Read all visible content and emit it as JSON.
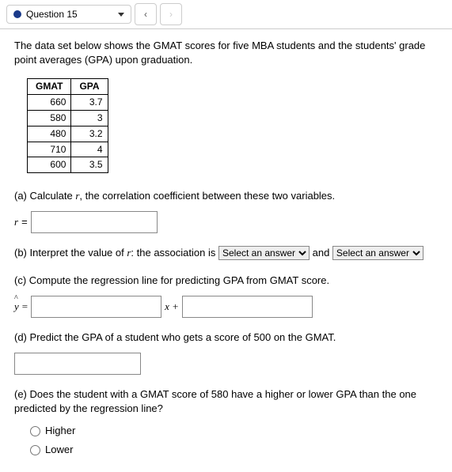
{
  "topbar": {
    "question_label": "Question 15",
    "prev": "‹",
    "next": "›"
  },
  "intro": "The data set below shows the GMAT scores for five MBA students and the students' grade point averages (GPA) upon graduation.",
  "table": {
    "headers": [
      "GMAT",
      "GPA"
    ],
    "rows": [
      [
        "660",
        "3.7"
      ],
      [
        "580",
        "3"
      ],
      [
        "480",
        "3.2"
      ],
      [
        "710",
        "4"
      ],
      [
        "600",
        "3.5"
      ]
    ]
  },
  "parts": {
    "a_pre": "(a) Calculate ",
    "a_var": "r",
    "a_post": ", the correlation coefficient between these two variables.",
    "a_lhs_var": "r",
    "a_lhs_eq": " = ",
    "b_pre": "(b) Interpret the value of ",
    "b_var": "r",
    "b_mid": ": the association is ",
    "b_and": " and ",
    "select_placeholder": "Select an answer",
    "c": "(c) Compute the regression line for predicting GPA from GMAT score.",
    "c_yhat": "y",
    "c_hat": "^",
    "c_eq": " = ",
    "c_xplus": "x + ",
    "d": "(d) Predict the GPA of a student who gets a score of 500 on the GMAT.",
    "e": "(e) Does the student with a GMAT score of 580 have a higher or lower GPA than the one predicted by the regression line?",
    "opt_higher": "Higher",
    "opt_lower": "Lower"
  }
}
